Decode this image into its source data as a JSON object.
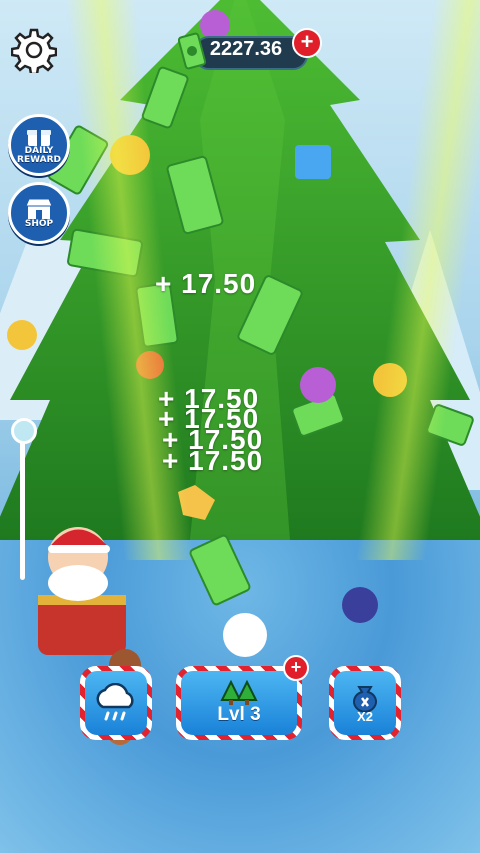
{
  "hud": {
    "currency_amount": "2227.36",
    "daily_reward_label_line1": "DAILY",
    "daily_reward_label_line2": "REWARD",
    "shop_label": "SHOP"
  },
  "floating_rewards": [
    "+ 17.50",
    "+ 17.50",
    "+ 17.50",
    "+ 17.50",
    "+ 17.50"
  ],
  "bottom_bar": {
    "level_label": "Lvl 3",
    "multiplier_label": "X2"
  },
  "colors": {
    "accent_red": "#e11f2b",
    "button_blue": "#1a82d8",
    "tree_green": "#2e9a2a"
  }
}
